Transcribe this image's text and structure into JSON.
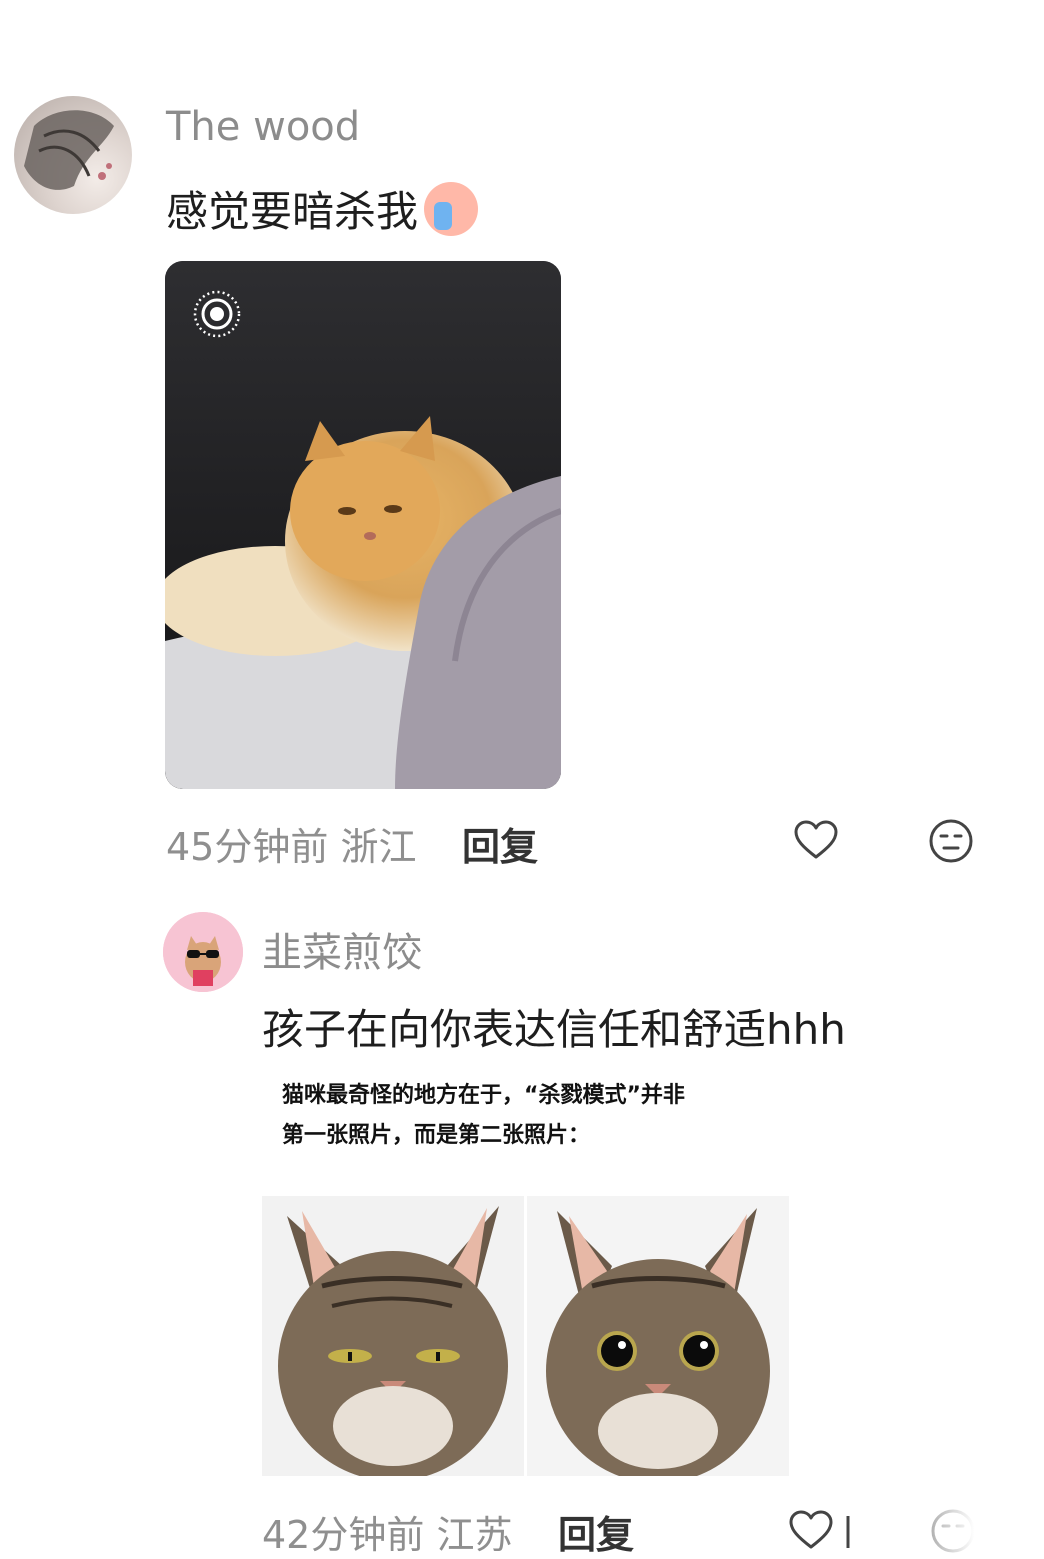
{
  "comments": [
    {
      "username": "The wood",
      "text": "感觉要暗杀我",
      "time": "45分钟前",
      "location": "浙江",
      "reply_label": "回复"
    },
    {
      "username": "韭菜煎饺",
      "text": "孩子在向你表达信任和舒适hhh",
      "image_caption_line1": "猫咪最奇怪的地方在于，“杀戮模式”并非",
      "image_caption_line2": "第一张照片，而是第二张照片：",
      "time": "42分钟前",
      "location": "江苏",
      "reply_label": "回复"
    }
  ],
  "icons": {
    "like": "heart-outline-icon",
    "dislike": "neutral-face-icon",
    "live_photo": "live-photo-icon",
    "emoji": "crying-face-emoji"
  },
  "colors": {
    "username": "#8c8c8c",
    "meta": "#8f8f8f",
    "text": "#1e1e1e",
    "icon": "#444444"
  }
}
